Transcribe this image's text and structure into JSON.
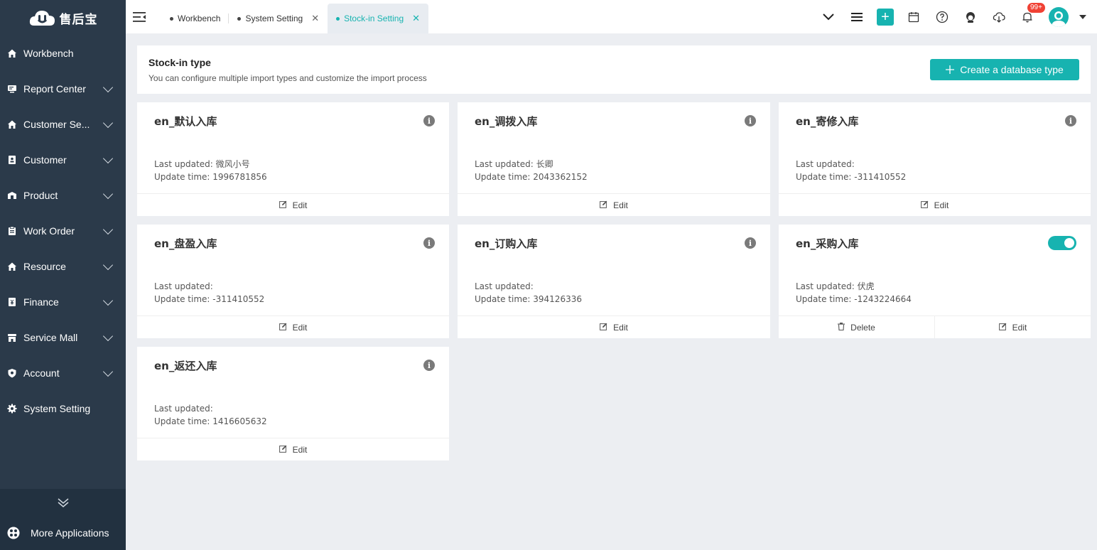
{
  "app": {
    "logo_text": "售后宝"
  },
  "sidebar": {
    "items": [
      {
        "label": "Workbench",
        "icon": "home-icon",
        "has_children": false
      },
      {
        "label": "Report Center",
        "icon": "report-icon",
        "has_children": true
      },
      {
        "label": "Customer Se...",
        "icon": "home-icon",
        "has_children": true
      },
      {
        "label": "Customer",
        "icon": "contact-icon",
        "has_children": true
      },
      {
        "label": "Product",
        "icon": "product-icon",
        "has_children": true
      },
      {
        "label": "Work Order",
        "icon": "clipboard-icon",
        "has_children": true
      },
      {
        "label": "Resource",
        "icon": "home-icon",
        "has_children": true
      },
      {
        "label": "Finance",
        "icon": "finance-icon",
        "has_children": true
      },
      {
        "label": "Service Mall",
        "icon": "store-icon",
        "has_children": true
      },
      {
        "label": "Account",
        "icon": "shield-icon",
        "has_children": true
      },
      {
        "label": "System Setting",
        "icon": "gear-icon",
        "has_children": false
      }
    ],
    "more_apps": "More Applications"
  },
  "tabs": [
    {
      "label": "Workbench",
      "closable": false,
      "active": false
    },
    {
      "label": "System Setting",
      "closable": true,
      "active": false
    },
    {
      "label": "Stock-in Setting",
      "closable": true,
      "active": true
    }
  ],
  "topbar": {
    "notification_badge": "99+"
  },
  "header": {
    "title": "Stock-in type",
    "description": "You can configure multiple import types and customize the import process",
    "create_button": "Create a database type"
  },
  "labels": {
    "last_updated": "Last updated:",
    "update_time": "Update time:",
    "edit": "Edit",
    "delete": "Delete"
  },
  "cards": [
    {
      "title": "en_默认入库",
      "last_updated_by": "微风小号",
      "update_time": "1996781856",
      "control": "info",
      "deletable": false
    },
    {
      "title": "en_调拨入库",
      "last_updated_by": "长卿",
      "update_time": "2043362152",
      "control": "info",
      "deletable": false
    },
    {
      "title": "en_寄修入库",
      "last_updated_by": "",
      "update_time": "-311410552",
      "control": "info",
      "deletable": false
    },
    {
      "title": "en_盘盈入库",
      "last_updated_by": "",
      "update_time": "-311410552",
      "control": "info",
      "deletable": false
    },
    {
      "title": "en_订购入库",
      "last_updated_by": "",
      "update_time": "394126336",
      "control": "info",
      "deletable": false
    },
    {
      "title": "en_采购入库",
      "last_updated_by": "伏虎",
      "update_time": "-1243224664",
      "control": "toggle",
      "toggle_on": true,
      "deletable": true
    },
    {
      "title": "en_返还入库",
      "last_updated_by": "",
      "update_time": "1416605632",
      "control": "info",
      "deletable": false
    }
  ],
  "colors": {
    "accent": "#17b3b0",
    "sidebar_bg": "#2b3a4a",
    "badge": "#f04134"
  }
}
